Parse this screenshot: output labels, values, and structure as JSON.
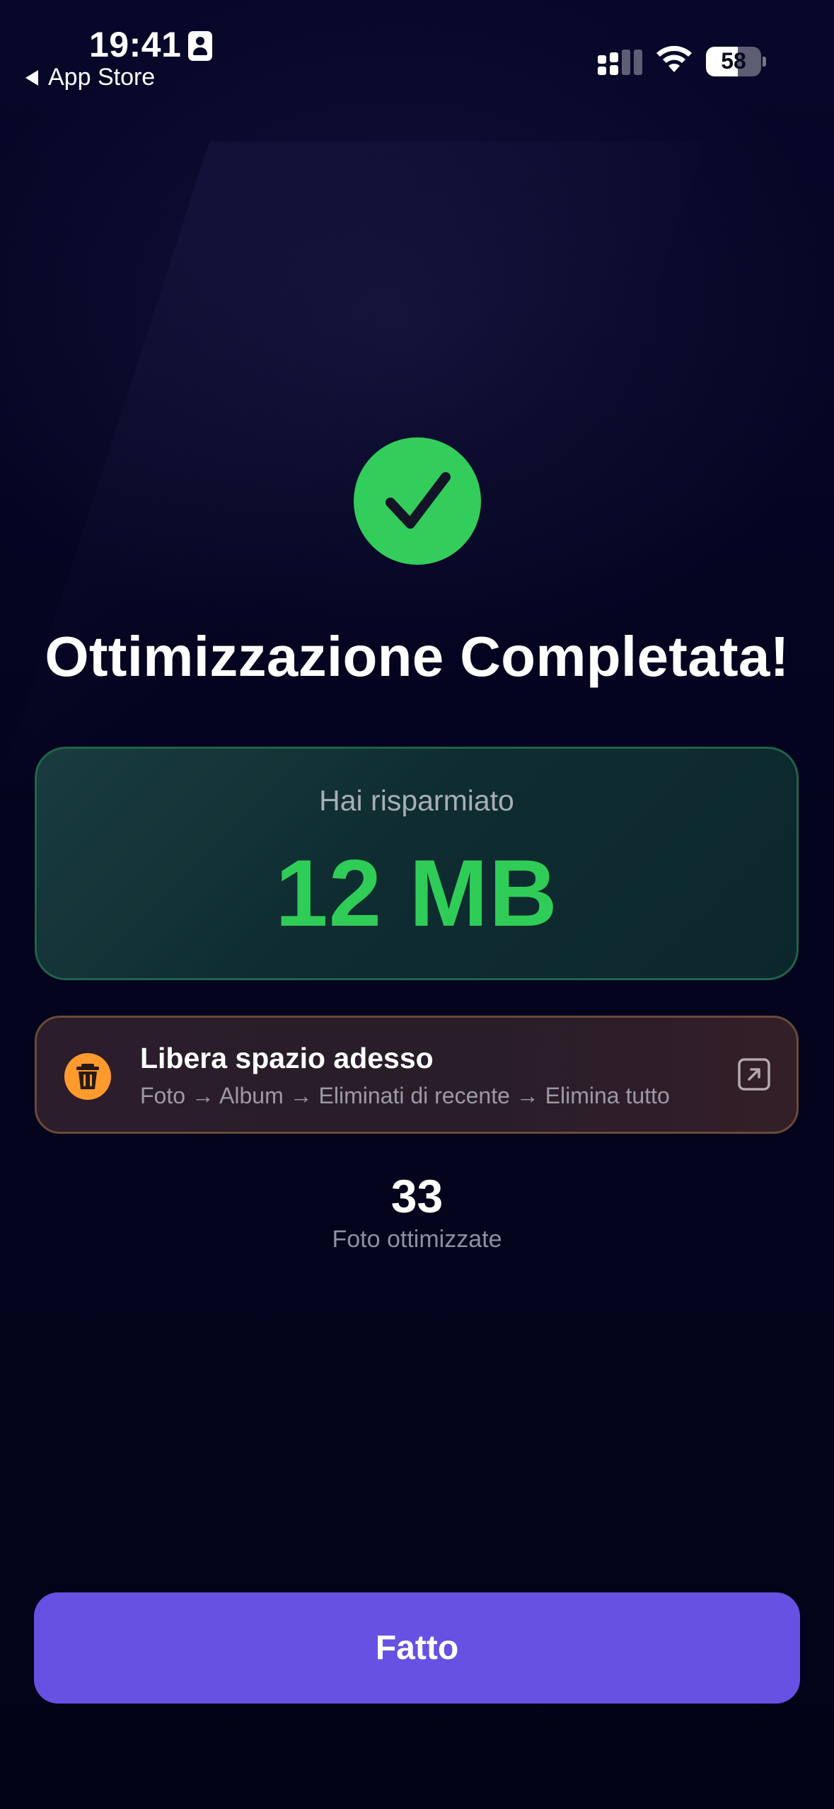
{
  "status_bar": {
    "time": "19:41",
    "back_label": "App Store",
    "battery_level": "58",
    "icons": [
      "id-badge-icon",
      "signal-icon",
      "wifi-icon",
      "battery-icon"
    ]
  },
  "result": {
    "title": "Ottimizzazione Completata!",
    "saved_label": "Hai risparmiato",
    "saved_value": "12 MB"
  },
  "free_space": {
    "title": "Libera spazio adesso",
    "path": "Foto → Album → Eliminati di recente → Elimina tutto",
    "icon": "trash-icon",
    "action_icon": "open-external-icon"
  },
  "stats": {
    "count": "33",
    "count_label": "Foto ottimizzate"
  },
  "actions": {
    "done_label": "Fatto"
  },
  "colors": {
    "background": "#04041c",
    "success_green": "#33cd5c",
    "accent_purple": "#6651e3",
    "warning_orange": "#ff9a2d"
  }
}
